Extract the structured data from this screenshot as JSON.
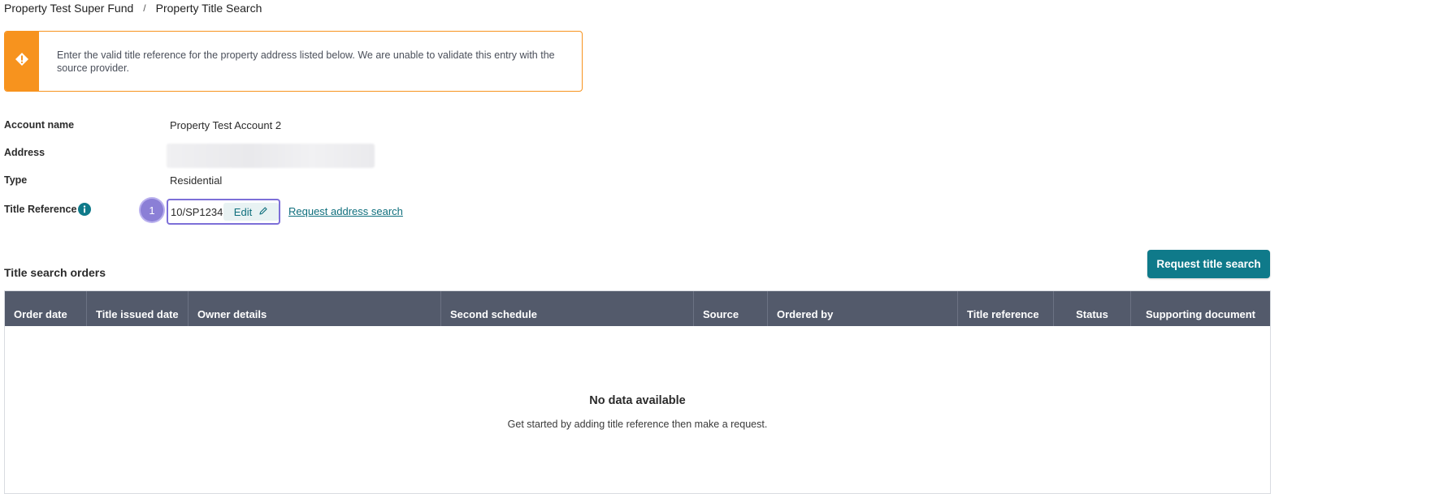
{
  "breadcrumb": {
    "items": [
      "Property Test Super Fund",
      "Property Title Search"
    ],
    "separator": "/"
  },
  "alert": {
    "icon": "warning-diamond-icon",
    "color": "#f7931e",
    "message": "Enter the valid title reference for the property address listed below. We are unable to validate this entry with the source provider."
  },
  "details": {
    "account_name_label": "Account name",
    "account_name_value": "Property Test Account 2",
    "address_label": "Address",
    "type_label": "Type",
    "type_value": "Residential",
    "title_reference_label": "Title Reference",
    "title_reference_value": "10/SP1234",
    "edit_label": "Edit",
    "step_number": "1",
    "request_address_search_label": "Request address search"
  },
  "orders": {
    "section_title": "Title search orders",
    "request_button_label": "Request title search",
    "columns": [
      "Order date",
      "Title issued date",
      "Owner details",
      "Second schedule",
      "Source",
      "Ordered by",
      "Title reference",
      "Status",
      "Supporting document"
    ],
    "empty_title": "No data available",
    "empty_message": "Get started by adding title reference then make a request."
  },
  "colors": {
    "accent": "#0f7a8a",
    "header_bg": "#535a6b",
    "highlight": "#7d6fd8",
    "warning": "#f7931e"
  }
}
